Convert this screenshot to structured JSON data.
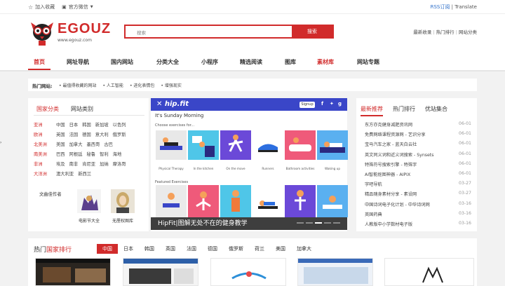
{
  "topbar": {
    "bookmark": "加入收藏",
    "wechat": "官方微信",
    "rss": "RSS订阅",
    "separator": "|",
    "translate": "Translate"
  },
  "header": {
    "logo_text": "EGOUZ",
    "logo_url": "www.egouz.com",
    "search_placeholder": "搜索",
    "search_button": "搜索",
    "links": [
      "最新收录",
      "热门排行",
      "网站分类"
    ]
  },
  "nav": {
    "items": [
      {
        "label": "首页",
        "state": "active"
      },
      {
        "label": "网址导航",
        "state": ""
      },
      {
        "label": "国内网站",
        "state": ""
      },
      {
        "label": "分类大全",
        "state": ""
      },
      {
        "label": "小程序",
        "state": ""
      },
      {
        "label": "精选阅读",
        "state": ""
      },
      {
        "label": "图库",
        "state": ""
      },
      {
        "label": "素材库",
        "state": "hot"
      },
      {
        "label": "网站专题",
        "state": ""
      }
    ]
  },
  "hotbar": {
    "label": "热门网站:",
    "items": [
      "最值得收藏的网站",
      "人工智能",
      "进化表情包",
      "增强现实"
    ]
  },
  "left_panel": {
    "tabs": [
      "国家分类",
      "网站类别"
    ],
    "rows": [
      {
        "continent": "亚洲",
        "countries": [
          "中国",
          "日本",
          "韩国",
          "新加坡",
          "以色列"
        ]
      },
      {
        "continent": "欧洲",
        "countries": [
          "英国",
          "法国",
          "德国",
          "意大利",
          "俄罗斯"
        ]
      },
      {
        "continent": "北美洲",
        "countries": [
          "美国",
          "加拿大",
          "墨西哥",
          "古巴"
        ]
      },
      {
        "continent": "南美洲",
        "countries": [
          "巴西",
          "阿根廷",
          "秘鲁",
          "智利",
          "海地"
        ]
      },
      {
        "continent": "非洲",
        "countries": [
          "埃及",
          "南非",
          "肯尼亚",
          "加纳",
          "摩洛哥"
        ]
      },
      {
        "continent": "大洋洲",
        "countries": [
          "澳大利亚",
          "新西兰"
        ]
      }
    ],
    "authors_title": "文曲佳作者",
    "authors": [
      "电影节大全",
      "无厘权图库"
    ]
  },
  "carousel": {
    "brand": "hip.fit",
    "signup": "Signup",
    "title": "It's Sunday Morning",
    "choose": "Choose exercises for...",
    "tiles": [
      "Physical Therapy",
      "In the kitchen",
      "On the move",
      "Runners",
      "Bathroom activities",
      "Waking up"
    ],
    "featured": "Featured Exercises",
    "caption": "HipFit|图解无处不在的健身教学"
  },
  "right_panel": {
    "tabs": [
      "最新推荐",
      "热门排行",
      "优站集合"
    ],
    "items": [
      {
        "title": "东方亦克健身减肥资讯网",
        "date": "06-01"
      },
      {
        "title": "免费网络课程资源网 - 艺识分享",
        "date": "06-01"
      },
      {
        "title": "宝马汽车之家 - 蓝天白云社",
        "date": "06-01"
      },
      {
        "title": "英文同义词和近义词搜索 - Synsets",
        "date": "06-01"
      },
      {
        "title": "特殊符号搜索引擎 - 特殊字",
        "date": "06-01"
      },
      {
        "title": "AI智能抠图神器 - AIPIX",
        "date": "06-01"
      },
      {
        "title": "字吧导航",
        "date": "03-27"
      },
      {
        "title": "精品随身素材分享 - 素设网",
        "date": "03-27"
      },
      {
        "title": "中国诗词电子化计划 - 中华诗词网",
        "date": "03-16"
      },
      {
        "title": "英国药典",
        "date": "03-16"
      },
      {
        "title": "人教版中小学数材电子版",
        "date": "03-16"
      }
    ]
  },
  "ranking": {
    "title_a": "热门",
    "title_b": "国家排行",
    "countries": [
      "中国",
      "日本",
      "韩国",
      "英国",
      "法国",
      "德国",
      "俄罗斯",
      "荷兰",
      "美国",
      "加拿大"
    ]
  },
  "colors": {
    "brand_red": "#d12b2b",
    "hipfit_blue": "#3a46c8"
  }
}
